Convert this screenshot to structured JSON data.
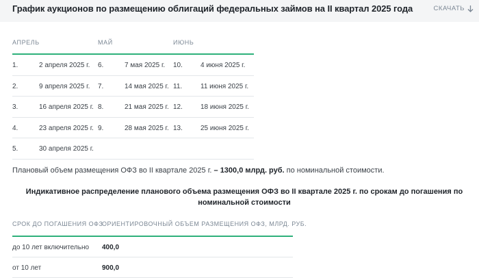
{
  "header": {
    "title": "График аукционов по размещению облигаций федеральных займов на II квартал 2025 года",
    "download_label": "СКАЧАТЬ"
  },
  "schedule": {
    "columns": [
      "АПРЕЛЬ",
      "МАЙ",
      "ИЮНЬ"
    ],
    "rows": [
      [
        "1.",
        "2 апреля 2025 г.",
        "6.",
        "7 мая 2025 г.",
        "10.",
        "4 июня 2025 г."
      ],
      [
        "2.",
        "9 апреля 2025 г.",
        "7.",
        "14 мая 2025 г.",
        "11.",
        "11 июня 2025 г."
      ],
      [
        "3.",
        "16 апреля 2025 г.",
        "8.",
        "21 мая 2025 г.",
        "12.",
        "18 июня 2025 г."
      ],
      [
        "4.",
        "23 апреля 2025 г.",
        "9.",
        "28 мая 2025 г.",
        "13.",
        "25 июня 2025 г."
      ],
      [
        "5.",
        "30 апреля 2025 г.",
        "",
        "",
        "",
        ""
      ]
    ]
  },
  "plan": {
    "prefix": "Плановый объем размещения ОФЗ во II квартале 2025 г.",
    "amount": "– 1300,0 млрд. руб.",
    "suffix": "по номинальной стоимости."
  },
  "distribution": {
    "title": "Индикативное распределение планового объема размещения ОФЗ во II квартале 2025 г. по срокам до погашения по номинальной стоимости",
    "columns": [
      "СРОК ДО ПОГАШЕНИЯ ОФЗ",
      "ОРИЕНТИРОВОЧНЫЙ ОБЪЕМ РАЗМЕЩЕНИЯ ОФЗ, МЛРД. РУБ."
    ],
    "rows": [
      [
        "до 10 лет включительно",
        "400,0"
      ],
      [
        "от 10 лет",
        "900,0"
      ]
    ]
  }
}
